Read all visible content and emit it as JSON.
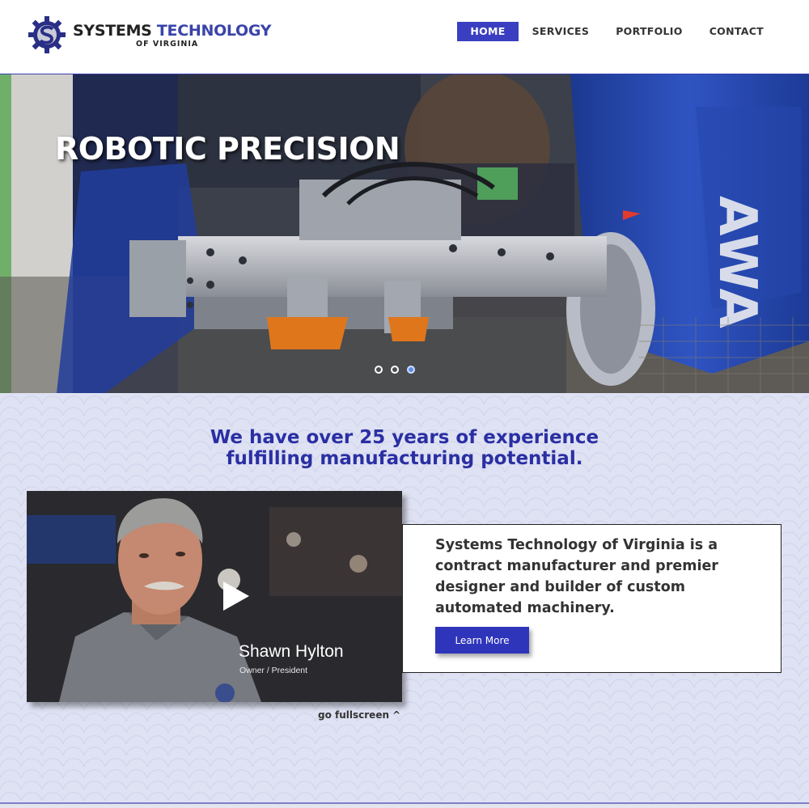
{
  "brand": {
    "name_part1": "SYSTEMS",
    "name_part2": "TECHNOLOGY",
    "tagline": "OF VIRGINIA",
    "colors": {
      "primary": "#3a3fc1",
      "headline": "#2a2fa3"
    }
  },
  "nav": {
    "items": [
      {
        "label": "HOME",
        "active": true
      },
      {
        "label": "SERVICES",
        "active": false
      },
      {
        "label": "PORTFOLIO",
        "active": false
      },
      {
        "label": "CONTACT",
        "active": false
      }
    ]
  },
  "hero": {
    "title": "ROBOTIC PRECISION",
    "robot_text": "AWA",
    "slide_count": 3,
    "active_slide": 3
  },
  "intro": {
    "headline_line1": "We have over 25 years of experience",
    "headline_line2": "fulfilling manufacturing potential."
  },
  "video": {
    "person_name": "Shawn Hylton",
    "person_role": "Owner / President",
    "fullscreen_label": "go fullscreen ^"
  },
  "about": {
    "text": "Systems Technology of Virginia is a contract manufacturer and premier designer and builder of custom automated machinery.",
    "button_label": "Learn More"
  }
}
